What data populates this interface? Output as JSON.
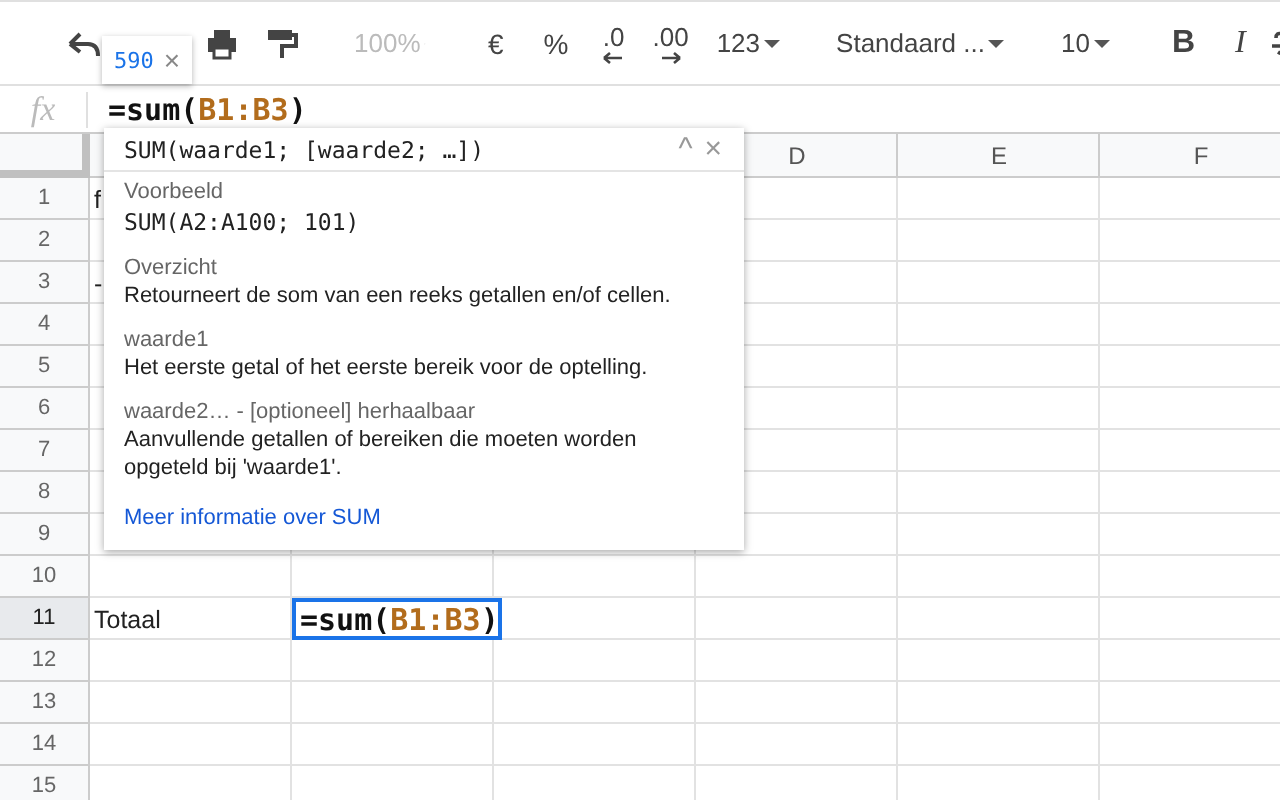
{
  "toolbar": {
    "items": [
      {
        "kind": "undo"
      },
      {
        "kind": "print"
      },
      {
        "kind": "paint"
      },
      {
        "kind": "separator"
      },
      {
        "kind": "zoom-dropdown",
        "label": "100%",
        "disabled": true
      },
      {
        "kind": "separator"
      },
      {
        "kind": "button",
        "label": "€"
      },
      {
        "kind": "button",
        "label": "%"
      },
      {
        "kind": "decimal-decrease",
        "label": ".0"
      },
      {
        "kind": "decimal-increase",
        "label": ".00"
      },
      {
        "kind": "format-dropdown",
        "label": "123",
        "disabled": false
      },
      {
        "kind": "separator"
      },
      {
        "kind": "font-dropdown",
        "label": "Standaard ...",
        "disabled": false
      },
      {
        "kind": "separator"
      },
      {
        "kind": "size-dropdown",
        "label": "10",
        "disabled": false
      },
      {
        "kind": "separator"
      },
      {
        "kind": "bold",
        "label": "B"
      },
      {
        "kind": "italic",
        "label": "I"
      },
      {
        "kind": "strike"
      }
    ]
  },
  "chip": {
    "value": "590",
    "close": "×"
  },
  "formula_bar": {
    "icon_text": "fx",
    "formula": [
      {
        "kind": "plain",
        "text": "=sum("
      },
      {
        "kind": "ref",
        "text": "B1:B3"
      },
      {
        "kind": "plain",
        "text": ")"
      }
    ]
  },
  "sheet": {
    "column_headers": [
      "D",
      "E",
      "F"
    ],
    "rows": [
      {
        "number": "1",
        "selected": false,
        "cells": [
          "f"
        ]
      },
      {
        "number": "2",
        "selected": false,
        "cells": []
      },
      {
        "number": "3",
        "selected": false,
        "cells": [
          "-"
        ]
      },
      {
        "number": "4",
        "selected": false,
        "cells": []
      },
      {
        "number": "5",
        "selected": false,
        "cells": []
      },
      {
        "number": "6",
        "selected": false,
        "cells": []
      },
      {
        "number": "7",
        "selected": false,
        "cells": []
      },
      {
        "number": "8",
        "selected": false,
        "cells": []
      },
      {
        "number": "9",
        "selected": false,
        "cells": []
      },
      {
        "number": "10",
        "selected": false,
        "cells": []
      },
      {
        "number": "11",
        "selected": true,
        "cells": [
          "Totaal",
          [
            {
              "kind": "plain",
              "text": "=sum("
            },
            {
              "kind": "ref",
              "text": "B1:B3"
            },
            {
              "kind": "plain",
              "text": ")"
            }
          ]
        ]
      },
      {
        "number": "12",
        "selected": false,
        "cells": []
      },
      {
        "number": "13",
        "selected": false,
        "cells": []
      },
      {
        "number": "14",
        "selected": false,
        "cells": []
      },
      {
        "number": "15",
        "selected": false,
        "cells": []
      }
    ]
  },
  "popup": {
    "signature": "SUM(waarde1; [waarde2; …])",
    "collapse": "^",
    "close": "×",
    "sections": [
      {
        "kind": "code",
        "label": "Voorbeeld",
        "text": "SUM(A2:A100; 101)"
      },
      {
        "kind": "text",
        "label": "Overzicht",
        "text": "Retourneert de som van een reeks getallen en/of cellen."
      },
      {
        "kind": "text",
        "label": "waarde1",
        "text": "Het eerste getal of het eerste bereik voor de optelling."
      },
      {
        "kind": "text",
        "label": "waarde2… - [optioneel] herhaalbaar",
        "text": "Aanvullende getallen of bereiken die moeten worden opgeteld bij 'waarde1'."
      }
    ],
    "link": "Meer informatie over SUM"
  }
}
